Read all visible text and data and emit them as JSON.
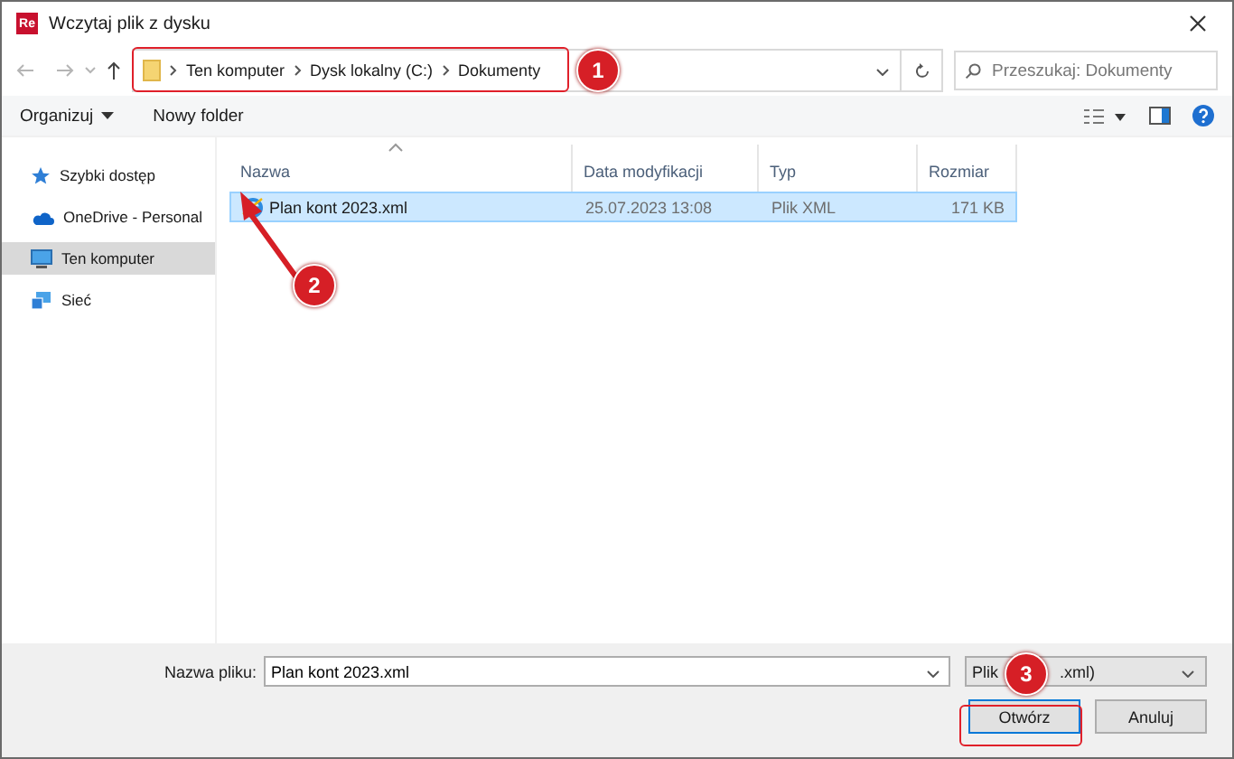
{
  "window": {
    "title": "Wczytaj plik z dysku",
    "app_icon": "Re"
  },
  "address_bar": {
    "breadcrumbs": [
      "Ten komputer",
      "Dysk lokalny (C:)",
      "Dokumenty"
    ]
  },
  "search": {
    "placeholder": "Przeszukaj: Dokumenty"
  },
  "toolbar": {
    "organize": "Organizuj",
    "new_folder": "Nowy folder"
  },
  "sidebar": {
    "items": [
      {
        "label": "Szybki dostęp",
        "kind": "star",
        "selected": false
      },
      {
        "label": "OneDrive - Personal",
        "kind": "cloud",
        "selected": false
      },
      {
        "label": "Ten komputer",
        "kind": "computer",
        "selected": true
      },
      {
        "label": "Sieć",
        "kind": "network",
        "selected": false
      }
    ]
  },
  "table": {
    "columns": [
      "Nazwa",
      "Data modyfikacji",
      "Typ",
      "Rozmiar"
    ],
    "rows": [
      {
        "name": "Plan kont 2023.xml",
        "date": "25.07.2023 13:08",
        "type": "Plik XML",
        "size": "171 KB",
        "selected": true
      }
    ]
  },
  "footer": {
    "filename_label": "Nazwa pliku:",
    "filename_value": "Plan kont 2023.xml",
    "filetype_left": "Plik",
    "filetype_right": ".xml)",
    "buttons": [
      "Otwórz",
      "Anuluj"
    ]
  },
  "annotations": [
    "1",
    "2",
    "3"
  ]
}
